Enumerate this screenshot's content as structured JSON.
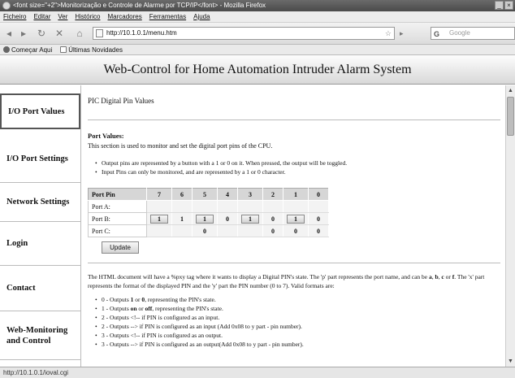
{
  "window": {
    "title": "<font size=\"+2\">Monitorização e Controle de Alarme por TCP/IP</font> - Mozilla Firefox",
    "minimize_label": "_",
    "close_label": "×"
  },
  "menubar": [
    "Ficheiro",
    "Editar",
    "Ver",
    "Histórico",
    "Marcadores",
    "Ferramentas",
    "Ajuda"
  ],
  "nav": {
    "url": "http://10.1.0.1/menu.htm",
    "search_placeholder": "Google",
    "back_glyph": "◂",
    "forward_glyph": "▸",
    "reload_glyph": "↻",
    "stop_glyph": "✕",
    "home_glyph": "⌂",
    "go_glyph": "▸",
    "star_glyph": "☆"
  },
  "bookmarks": [
    "Começar Aqui",
    "Últimas Novidades"
  ],
  "banner_title": "Web-Control for Home Automation Intruder Alarm System",
  "sidebar": {
    "items": [
      {
        "label": "I/O Port Values"
      },
      {
        "label": "I/O Port Settings"
      },
      {
        "label": "Network Settings"
      },
      {
        "label": "Login"
      },
      {
        "label": "Contact"
      },
      {
        "label": "Web-Monitoring and Control"
      }
    ]
  },
  "content": {
    "section_title": "PIC Digital Pin Values",
    "port_values_heading": "Port Values:",
    "port_values_desc": "This section is used to monitor and set the digital port pins of the CPU.",
    "bullets": [
      "Output pins are represented by a button with a 1 or 0 on it. When pressed, the output will be toggled.",
      "Input Pins can only be monitored, and are represented by a 1 or 0 character."
    ],
    "table": {
      "header": [
        "Port Pin",
        "7",
        "6",
        "5",
        "4",
        "3",
        "2",
        "1",
        "0"
      ],
      "rows": [
        {
          "name": "Port A:",
          "cells": [
            {
              "v": "",
              "btn": false
            },
            {
              "v": "",
              "btn": false
            },
            {
              "v": "",
              "btn": false
            },
            {
              "v": "",
              "btn": false
            },
            {
              "v": "",
              "btn": false
            },
            {
              "v": "",
              "btn": false
            },
            {
              "v": "",
              "btn": false
            },
            {
              "v": "",
              "btn": false
            }
          ]
        },
        {
          "name": "Port B:",
          "cells": [
            {
              "v": "1",
              "btn": true
            },
            {
              "v": "1",
              "btn": false
            },
            {
              "v": "1",
              "btn": true
            },
            {
              "v": "0",
              "btn": false
            },
            {
              "v": "1",
              "btn": true
            },
            {
              "v": "0",
              "btn": false
            },
            {
              "v": "1",
              "btn": true
            },
            {
              "v": "0",
              "btn": false
            }
          ]
        },
        {
          "name": "Port C:",
          "cells": [
            {
              "v": "",
              "btn": false
            },
            {
              "v": "",
              "btn": false
            },
            {
              "v": "0",
              "btn": false
            },
            {
              "v": "",
              "btn": false
            },
            {
              "v": "",
              "btn": false
            },
            {
              "v": "0",
              "btn": false
            },
            {
              "v": "0",
              "btn": false
            },
            {
              "v": "0",
              "btn": false
            }
          ]
        }
      ]
    },
    "update_label": "Update",
    "html_desc": [
      {
        "t": "The HTML document will have a %pxy tag where it wants to display a Digital PIN's state. The 'p' part represents the port name, and can be "
      },
      {
        "t": "a",
        "b": true
      },
      {
        "t": ", "
      },
      {
        "t": "b",
        "b": true
      },
      {
        "t": ", "
      },
      {
        "t": "c",
        "b": true
      },
      {
        "t": " or "
      },
      {
        "t": "f",
        "b": true
      },
      {
        "t": ". The 'x' part represents the format of the displayed PIN and the 'y' part the PIN number (0 to 7). Valid formats are:"
      }
    ],
    "format_bullets": [
      [
        {
          "t": "0 - Outputs "
        },
        {
          "t": "1",
          "b": true
        },
        {
          "t": " or "
        },
        {
          "t": "0",
          "b": true
        },
        {
          "t": ", representing the PIN's state."
        }
      ],
      [
        {
          "t": "1 - Outputs "
        },
        {
          "t": "on",
          "b": true
        },
        {
          "t": " or "
        },
        {
          "t": "off",
          "b": true
        },
        {
          "t": ", representing the PIN's state."
        }
      ],
      [
        {
          "t": "2 - Outputs <!-- if PIN is configured as an input."
        }
      ],
      [
        {
          "t": "2 - Outputs --> if PIN is configured as an input (Add 0x08 to y part - pin number)."
        }
      ],
      [
        {
          "t": "3 - Outputs <!-- if PIN is configured as an output."
        }
      ],
      [
        {
          "t": "3 - Outputs --> if PIN is configured as an output(Add 0x08 to y part - pin number)."
        }
      ]
    ]
  },
  "status": "http://10.1.0.1/ioval.cgi",
  "scroll": {
    "up": "▲",
    "down": "▼"
  }
}
